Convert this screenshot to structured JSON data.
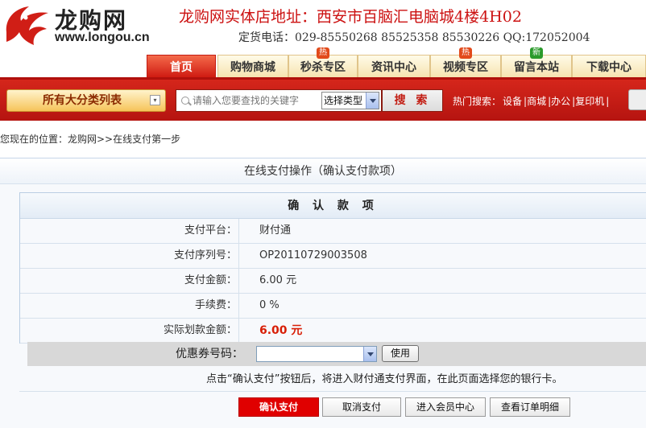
{
  "header": {
    "logo_name": "龙购网",
    "logo_url": "www.longou.cn",
    "store_address": "龙购网实体店地址：西安市百脑汇电脑城4楼4H02",
    "phone": "定货电话：029-85550268  85525358  85530226  QQ:172052004"
  },
  "nav": {
    "tabs": [
      {
        "label": "首页",
        "active": true
      },
      {
        "label": "购物商城"
      },
      {
        "label": "秒杀专区",
        "badge": "热"
      },
      {
        "label": "资讯中心"
      },
      {
        "label": "视频专区",
        "badge": "热"
      },
      {
        "label": "留言本站",
        "badge": "新"
      },
      {
        "label": "下载中心"
      }
    ]
  },
  "searchbar": {
    "category_label": "所有大分类列表",
    "search_placeholder": "请输入您要查找的关键字",
    "type_select": "选择类型",
    "search_button": "搜 索",
    "hot_label": "热门搜索：",
    "hot_items": [
      "设备",
      "商城",
      "办公",
      "复印机"
    ]
  },
  "breadcrumb": "您现在的位置：龙购网>>在线支付第一步",
  "panel": {
    "title": "在线支付操作（确认支付款项）",
    "table_title": "确 认 款 项",
    "rows": [
      {
        "label": "支付平台：",
        "value": "财付通"
      },
      {
        "label": "支付序列号：",
        "value": "OP20110729003508"
      },
      {
        "label": "支付金额：",
        "value": "6.00 元"
      },
      {
        "label": "手续费：",
        "value": "0 %"
      },
      {
        "label": "实际划款金额：",
        "value": "6.00 元"
      }
    ],
    "coupon_label": "优惠券号码：",
    "coupon_value": "",
    "use_button": "使用",
    "notice": "点击“确认支付”按钮后，将进入财付通支付界面，在此页面选择您的银行卡。",
    "buttons": {
      "confirm": "确认支付",
      "cancel": "取消支付",
      "member": "进入会员中心",
      "orders": "查看订单明细"
    }
  },
  "colors": {
    "brand_red": "#d5261b",
    "amount_red": "#d81e06",
    "link_blue": "#b9cde3"
  }
}
